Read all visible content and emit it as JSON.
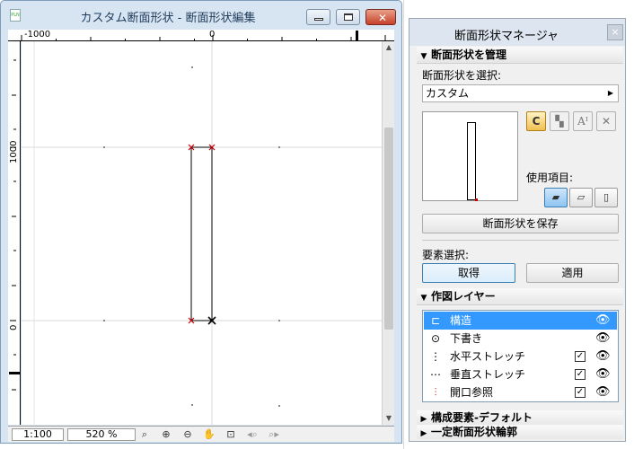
{
  "editor": {
    "title": "カスタム断面形状 - 断面形状編集",
    "app_icon": "PLN",
    "window_buttons": {
      "minimize": "minimize-icon",
      "maximize": "maximize-icon",
      "close": "✕"
    },
    "ruler_top_labels": [
      "-1000",
      "0"
    ],
    "ruler_left_labels": [
      "1000",
      "0"
    ],
    "status": {
      "scale": "1:100",
      "zoom": "520 %",
      "tools": [
        "zoom-options-icon",
        "zoom-in-icon",
        "zoom-out-icon",
        "pan-hand-icon",
        "fit-in-window-icon",
        "previous-zoom-icon",
        "next-zoom-icon"
      ]
    }
  },
  "palette": {
    "title": "断面形状マネージャ",
    "close": "×",
    "manage": {
      "header": "断面形状を管理",
      "select_label": "断面形状を選択:",
      "selected_profile": "カスタム",
      "actions": [
        "new-profile-icon",
        "duplicate-profile-icon",
        "rename-profile-icon",
        "delete-profile-icon"
      ],
      "use_label": "使用項目:",
      "use_options": [
        "wall-icon",
        "beam-icon",
        "column-icon"
      ],
      "save_button": "断面形状を保存"
    },
    "element_select": {
      "label": "要素選択:",
      "get_button": "取得",
      "apply_button": "適用"
    },
    "layers": {
      "header": "作図レイヤー",
      "items": [
        {
          "name": "構造",
          "icon": "structure-layer-icon",
          "checkbox": false,
          "visible": true,
          "selected": true
        },
        {
          "name": "下書き",
          "icon": "draft-layer-icon",
          "checkbox": false,
          "visible": true,
          "selected": false
        },
        {
          "name": "水平ストレッチ",
          "icon": "horizontal-stretch-icon",
          "checkbox": true,
          "visible": true,
          "selected": false
        },
        {
          "name": "垂直ストレッチ",
          "icon": "vertical-stretch-icon",
          "checkbox": true,
          "visible": true,
          "selected": false
        },
        {
          "name": "開口参照",
          "icon": "opening-reference-icon",
          "checkbox": true,
          "visible": true,
          "selected": false
        }
      ],
      "check_mark": "✓",
      "eye_glyph": "👁"
    },
    "footer": {
      "defaults_header": "構成要素-デフォルト",
      "outline_header": "一定断面形状輪郭"
    }
  }
}
